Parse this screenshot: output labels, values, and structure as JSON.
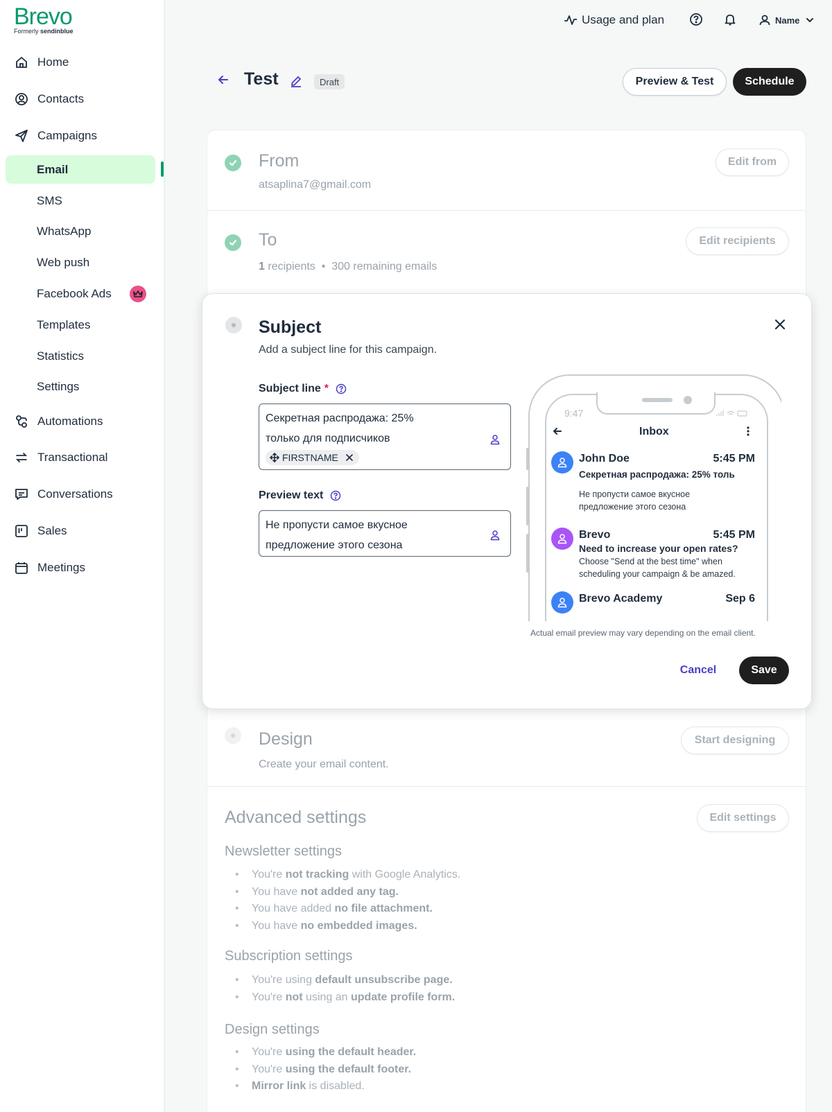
{
  "brand": {
    "name": "Brevo",
    "formerly_prefix": "Formerly",
    "formerly_name": "sendinblue",
    "color": "#0b996e"
  },
  "sidebar": {
    "items": [
      {
        "label": "Home",
        "icon": "home-icon"
      },
      {
        "label": "Contacts",
        "icon": "contacts-icon"
      },
      {
        "label": "Campaigns",
        "icon": "send-icon"
      },
      {
        "label": "Automations",
        "icon": "automation-icon"
      },
      {
        "label": "Transactional",
        "icon": "transfer-icon"
      },
      {
        "label": "Conversations",
        "icon": "chat-icon"
      },
      {
        "label": "Sales",
        "icon": "kanban-icon"
      },
      {
        "label": "Meetings",
        "icon": "calendar-icon"
      }
    ],
    "campaign_subitems": [
      "Email",
      "SMS",
      "WhatsApp",
      "Web push",
      "Facebook Ads",
      "Templates",
      "Statistics",
      "Settings"
    ],
    "active": "Email",
    "active_bg": "#d7fcdb"
  },
  "header": {
    "usage_label": "Usage and plan",
    "user_name": "Name"
  },
  "campaign": {
    "title": "Test",
    "status_badge": "Draft",
    "preview_button": "Preview & Test",
    "schedule_button": "Schedule"
  },
  "from": {
    "title": "From",
    "value": "atsaplina7@gmail.com",
    "button": "Edit from"
  },
  "to": {
    "title": "To",
    "count": "1",
    "count_suffix": "recipients",
    "separator": "•",
    "remaining": "300 remaining emails",
    "button": "Edit recipients"
  },
  "subject": {
    "title": "Subject",
    "description": "Add a subject line for this campaign.",
    "subject_label": "Subject line",
    "required_mark": "*",
    "subject_line_1": "Секретная распродажа: 25%",
    "subject_line_2": "только для подписчиков",
    "personalization_tag": "FIRSTNAME",
    "preview_label": "Preview text",
    "preview_line_1": "Не пропусти самое вкусное",
    "preview_line_2": "предложение этого сезона",
    "disclaimer": "Actual email preview may vary depending on the email client.",
    "cancel": "Cancel",
    "save": "Save"
  },
  "phone": {
    "time": "9:47",
    "screen_title": "Inbox",
    "messages": [
      {
        "sender": "John Doe",
        "time": "5:45 PM",
        "subject": "Секретная распродажа: 25% толь",
        "body_1": "Не пропусти самое вкусное",
        "body_2": "предложение этого сезона",
        "avatar_color": "#3b82f6"
      },
      {
        "sender": "Brevo",
        "time": "5:45 PM",
        "subject": "Need to increase your open rates?",
        "body_1": "Choose \"Send at the best time\" when",
        "body_2": "scheduling your campaign & be amazed.",
        "avatar_color": "#a855f7"
      },
      {
        "sender": "Brevo Academy",
        "time": "Sep 6",
        "avatar_color": "#3b82f6"
      }
    ]
  },
  "design": {
    "title": "Design",
    "description": "Create your email content.",
    "button": "Start designing"
  },
  "advanced": {
    "title": "Advanced settings",
    "button": "Edit settings",
    "newsletter": {
      "heading": "Newsletter settings",
      "items": [
        {
          "pre": "You're ",
          "bold": "not tracking",
          "post": " with Google Analytics."
        },
        {
          "pre": "You have ",
          "bold": "not added any tag.",
          "post": ""
        },
        {
          "pre": "You have added ",
          "bold": "no file attachment.",
          "post": ""
        },
        {
          "pre": "You have ",
          "bold": "no embedded images.",
          "post": ""
        }
      ]
    },
    "subscription": {
      "heading": "Subscription settings",
      "items": [
        {
          "pre": "You're using ",
          "bold": "default unsubscribe page.",
          "post": ""
        },
        {
          "pre": "You're ",
          "bold": "not",
          "post": " using an ",
          "bold2": "update profile form."
        }
      ]
    },
    "design": {
      "heading": "Design settings",
      "items": [
        {
          "pre": "You're ",
          "bold": "using the default header.",
          "post": ""
        },
        {
          "pre": "You're ",
          "bold": "using the default footer.",
          "post": ""
        },
        {
          "pre": "",
          "bold": "Mirror link",
          "post": " is disabled."
        }
      ]
    }
  }
}
